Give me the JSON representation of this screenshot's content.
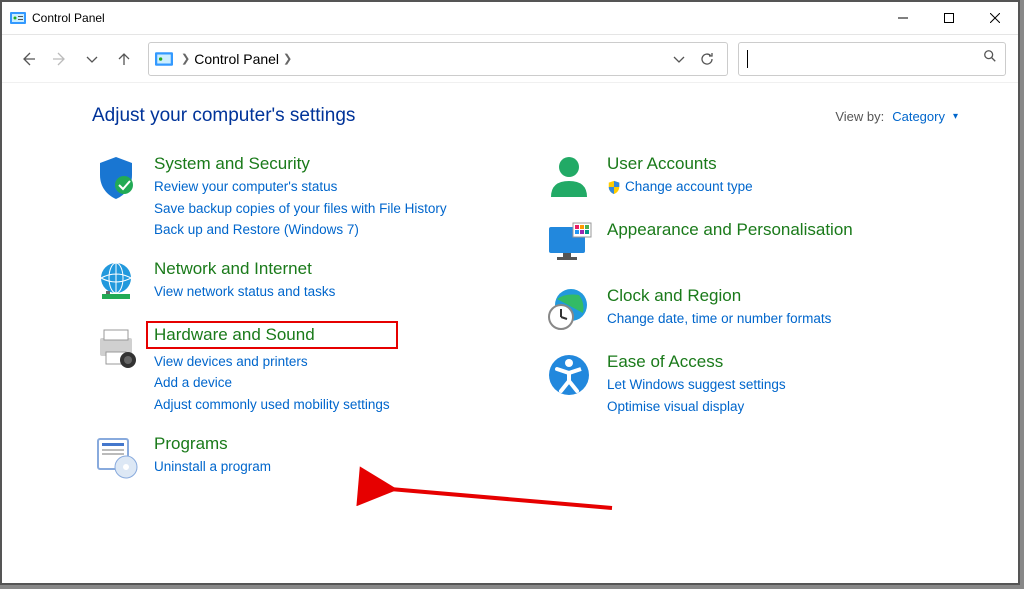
{
  "window": {
    "title": "Control Panel"
  },
  "breadcrumb": {
    "root": "Control Panel"
  },
  "header": {
    "page_title": "Adjust your computer's settings",
    "viewby_label": "View by:",
    "viewby_value": "Category"
  },
  "left": [
    {
      "title": "System and Security",
      "links": [
        "Review your computer's status",
        "Save backup copies of your files with File History",
        "Back up and Restore (Windows 7)"
      ]
    },
    {
      "title": "Network and Internet",
      "links": [
        "View network status and tasks"
      ]
    },
    {
      "title": "Hardware and Sound",
      "highlight": true,
      "links": [
        "View devices and printers",
        "Add a device",
        "Adjust commonly used mobility settings"
      ]
    },
    {
      "title": "Programs",
      "links": [
        "Uninstall a program"
      ]
    }
  ],
  "right": [
    {
      "title": "User Accounts",
      "links": [
        "Change account type"
      ],
      "shield": true
    },
    {
      "title": "Appearance and Personalisation",
      "links": []
    },
    {
      "title": "Clock and Region",
      "links": [
        "Change date, time or number formats"
      ]
    },
    {
      "title": "Ease of Access",
      "links": [
        "Let Windows suggest settings",
        "Optimise visual display"
      ]
    }
  ]
}
